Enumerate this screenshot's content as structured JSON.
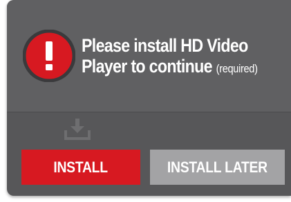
{
  "dialog": {
    "title_line1": "Please install HD Video",
    "title_line2": "Player to continue",
    "required_note": "(required)",
    "alert_icon": "exclamation-circle-icon",
    "download_icon": "download-tray-icon",
    "install_label": "INSTALL",
    "install_later_label": "INSTALL LATER"
  },
  "colors": {
    "panel": "#575759",
    "header": "#606062",
    "accent_red": "#d71921",
    "secondary_gray": "#a3a3a5",
    "text": "#ffffff"
  }
}
